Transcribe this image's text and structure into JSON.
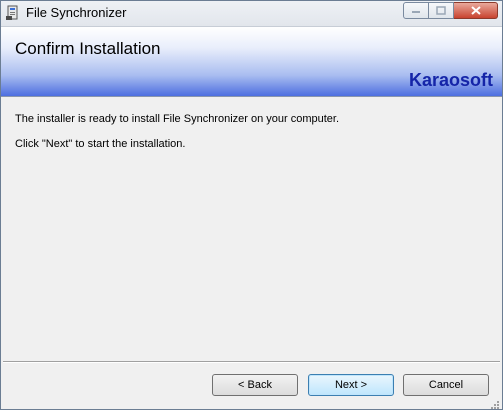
{
  "window": {
    "title": "File Synchronizer",
    "icon": "installer-app-icon",
    "controls": [
      "minimize-icon",
      "maximize-icon",
      "close-icon"
    ]
  },
  "banner": {
    "title": "Confirm Installation",
    "brand": "Karaosoft",
    "brand_color": "#1525a8"
  },
  "content": {
    "line1": "The installer is ready to install File Synchronizer on your computer.",
    "line2": "Click \"Next\" to start the installation."
  },
  "buttons": {
    "back": "< Back",
    "next": "Next >",
    "cancel": "Cancel"
  }
}
